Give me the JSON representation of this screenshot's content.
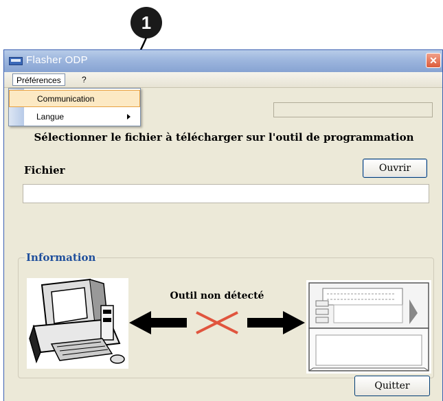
{
  "callout": {
    "number": "1"
  },
  "window": {
    "title": "Flasher ODP",
    "close_glyph": "✕"
  },
  "menubar": {
    "items": [
      {
        "label": "Préférences"
      },
      {
        "label": "?"
      }
    ]
  },
  "dropdown": {
    "items": [
      {
        "label": "Communication",
        "highlighted": true
      },
      {
        "label": "Langue",
        "has_submenu": true
      }
    ]
  },
  "main": {
    "instruction": "Sélectionner le fichier à télécharger sur l'outil de programmation",
    "file_label": "Fichier",
    "open_button": "Ouvrir",
    "file_value": ""
  },
  "info": {
    "title": "Information",
    "status": "Outil non détecté",
    "icons": [
      "computer-illustration",
      "arrows-link-broken",
      "programming-tool-illustration"
    ]
  },
  "footer": {
    "quit_button": "Quitter"
  },
  "colors": {
    "titlebar": "#9db6de",
    "window_bg": "#ece9d8",
    "info_title": "#1f4f9c",
    "cross": "#e0553e",
    "menu_highlight": "#fce9c4"
  }
}
